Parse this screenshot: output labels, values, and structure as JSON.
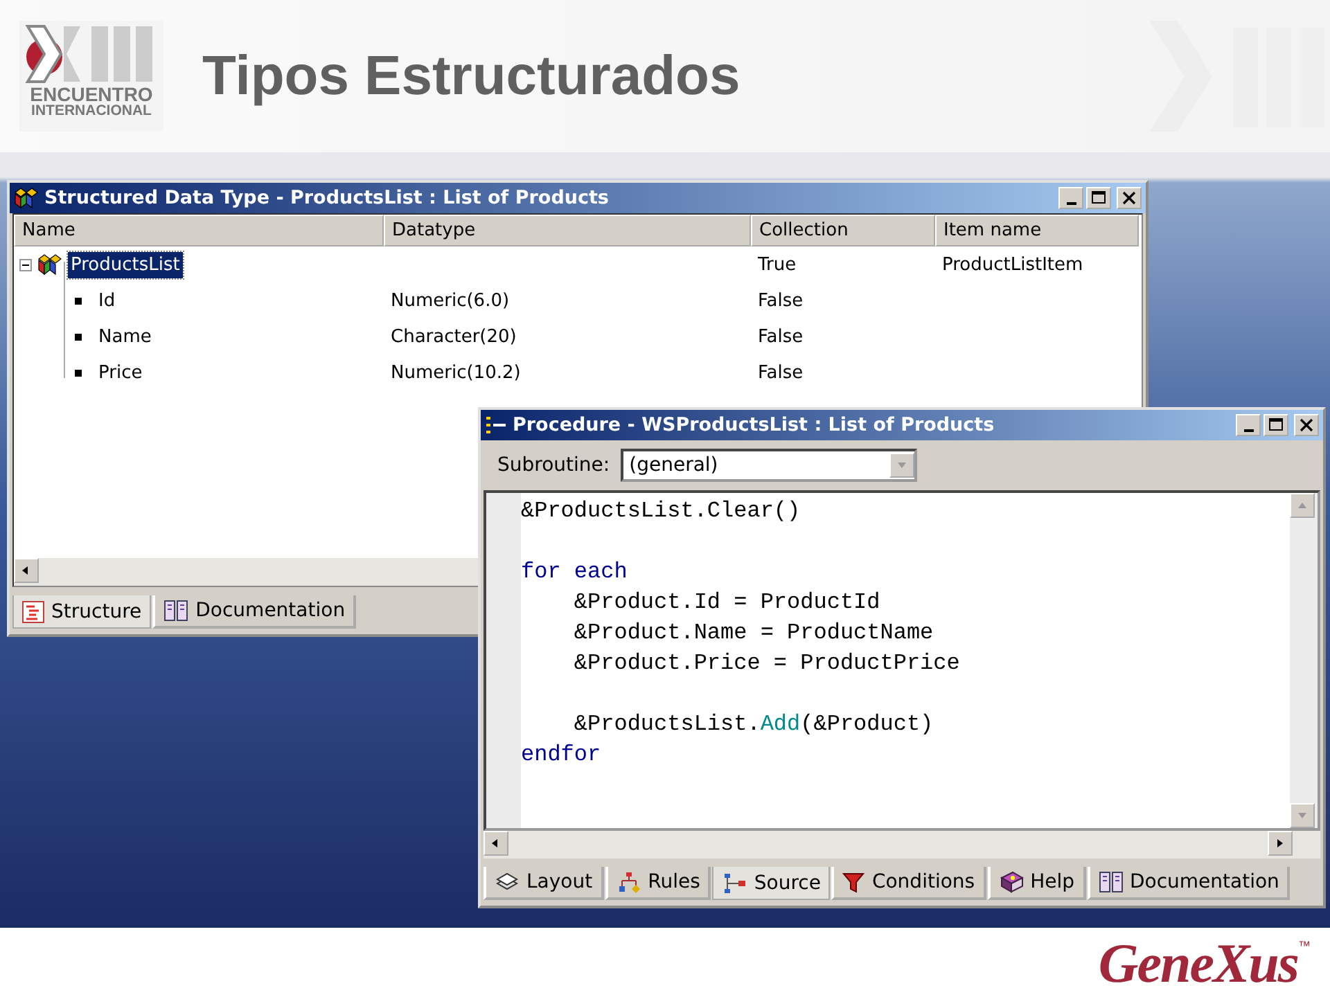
{
  "slide": {
    "title": "Tipos Estructurados",
    "event_logo": {
      "line_1": "ENCUENTRO",
      "line_2": "INTERNACIONAL"
    },
    "brand_logo": {
      "name": "GeneXus",
      "mark": "™"
    }
  },
  "structure_window": {
    "title": "Structured Data Type - ProductsList : List of Products",
    "columns": [
      "Name",
      "Datatype",
      "Collection",
      "Item name"
    ],
    "tree": [
      {
        "name": "ProductsList",
        "collection": "True",
        "item_name": "ProductListItem",
        "selected": true,
        "expanded": true,
        "children": [
          {
            "name": "Id",
            "datatype": "Numeric(6.0)",
            "collection": "False",
            "selected": false
          },
          {
            "name": "Name",
            "datatype": "Character(20)",
            "collection": "False",
            "selected": false
          },
          {
            "name": "Price",
            "datatype": "Numeric(10.2)",
            "collection": "False",
            "selected": false
          }
        ]
      }
    ],
    "tabs": [
      {
        "label": "Structure",
        "selected": true
      },
      {
        "label": "Documentation",
        "selected": false
      }
    ]
  },
  "procedure_window": {
    "title": "Procedure - WSProductsList : List of Products",
    "subroutine_label": "Subroutine:",
    "subroutine": {
      "value": "(general)"
    },
    "code_lines": [
      {
        "kind": "code",
        "segments": [
          {
            "text": "&ProductsList.Clear()",
            "kind": "plain"
          }
        ]
      },
      {
        "kind": "blank"
      },
      {
        "kind": "code",
        "segments": [
          {
            "text": "for each",
            "kind": "keyword"
          }
        ]
      },
      {
        "kind": "code",
        "segments": [
          {
            "text": "    &Product.Id = ProductId",
            "kind": "plain"
          }
        ]
      },
      {
        "kind": "code",
        "segments": [
          {
            "text": "    &Product.Name = ProductName",
            "kind": "plain"
          }
        ]
      },
      {
        "kind": "code",
        "segments": [
          {
            "text": "    &Product.Price = ProductPrice",
            "kind": "plain"
          }
        ]
      },
      {
        "kind": "blank"
      },
      {
        "kind": "code",
        "segments": [
          {
            "text": "    &ProductsList.",
            "kind": "plain"
          },
          {
            "text": "Add",
            "kind": "method"
          },
          {
            "text": "(&Product)",
            "kind": "plain"
          }
        ]
      },
      {
        "kind": "code",
        "segments": [
          {
            "text": "endfor",
            "kind": "keyword"
          }
        ]
      }
    ],
    "tabs": [
      {
        "label": "Layout",
        "selected": false
      },
      {
        "label": "Rules",
        "selected": false
      },
      {
        "label": "Source",
        "selected": true
      },
      {
        "label": "Conditions",
        "selected": false
      },
      {
        "label": "Help",
        "selected": false
      },
      {
        "label": "Documentation",
        "selected": false
      }
    ]
  }
}
